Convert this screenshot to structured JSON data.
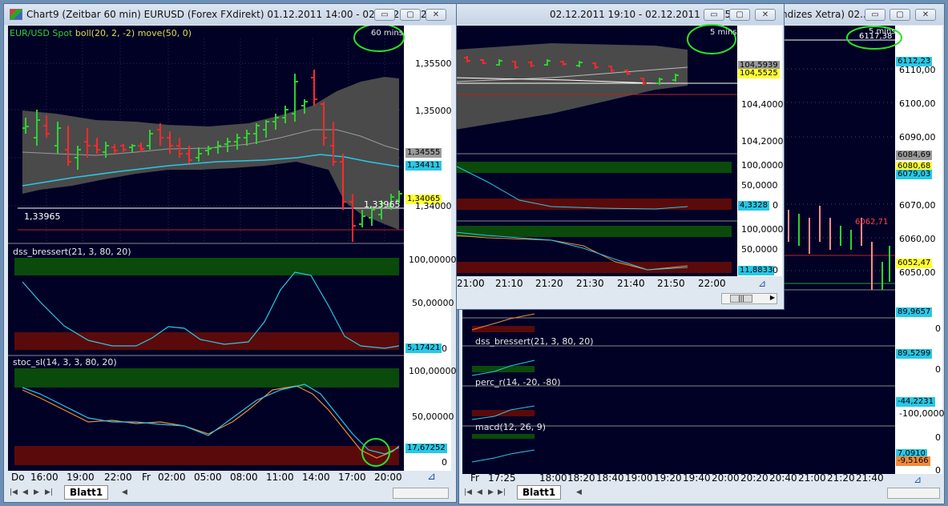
{
  "colors": {
    "chart_bg": "#010126",
    "bull": "#2fd12f",
    "bear": "#ff2a2a",
    "band": "#4a4a4a",
    "ma": "#28c8e6",
    "overbought": "#0a4a0a",
    "oversold": "#5a0a0a",
    "annotation": "#27e427"
  },
  "win1": {
    "title": "Chart9 (Zeitbar 60 min)  EURUSD (Forex FXdirekt) 01.12.2011 14:00 - 02.12.2011 2...",
    "buttons": {
      "min": "▭",
      "max": "▢",
      "close": "✕"
    },
    "legend_symbol": "EUR/USD Spot",
    "legend_ind": "boll(20, 2, -2)",
    "legend_ma": "move(50, 0)",
    "interval_note": "60 mins",
    "price_labels": [
      "1,35500",
      "1,35000",
      "1,34000"
    ],
    "boxes": [
      {
        "text": "1,34555"
      },
      {
        "text": "1,34411"
      },
      {
        "text": "1,34065"
      }
    ],
    "hline_label": "1,33965",
    "hline_label2": "1,33965",
    "pane2_title": "dss_bressert(21, 3, 80, 20)",
    "pane2_labels": [
      "100,00000",
      "50,00000",
      "0"
    ],
    "pane2_box": "5,17421",
    "pane3_title": "stoc_sl(14, 3, 3, 80, 20)",
    "pane3_labels": [
      "100,00000",
      "50,00000",
      "0"
    ],
    "pane3_box": "17,67252",
    "time_labels": [
      "Do",
      "16:00",
      "19:00",
      "22:00",
      "Fr",
      "02:00",
      "05:00",
      "08:00",
      "11:00",
      "14:00",
      "17:00",
      "20:00"
    ],
    "tab": "Blatt1",
    "nav": [
      "|◀",
      "◀",
      "▶",
      "▶|"
    ],
    "scroll_left": "◀"
  },
  "win2": {
    "title": "02.12.2011 19:10 - 02.12.2011 22:05",
    "buttons": {
      "min": "▭",
      "max": "▢",
      "close": "✕"
    },
    "interval_note": "5 mins",
    "price_labels": [
      "104,4000",
      "104,2000"
    ],
    "price_boxes": [
      "104,5939",
      "104,5525"
    ],
    "pane2_labels": [
      "100,0000",
      "50,0000",
      "0"
    ],
    "pane2_box": "4,3328",
    "pane3_labels": [
      "100,0000",
      "50,0000",
      "0"
    ],
    "pane3_box": "11,8833",
    "time_labels": [
      "21:00",
      "21:10",
      "21:20",
      "21:30",
      "21:40",
      "21:50",
      "22:00"
    ],
    "scroll_thumb": "|||",
    "scroll_right": "▶"
  },
  "win3": {
    "title": "ndizes Xetra) 02....",
    "buttons": {
      "min": "▭",
      "max": "▢",
      "close": "✕"
    },
    "interval_note": "5 mins",
    "top_box": "6112,23",
    "top_label": "6117,38",
    "price_labels": [
      "6110,00",
      "6100,00",
      "6090,00",
      "6070,00",
      "6060,00",
      "6050,00"
    ],
    "boxes": [
      "6084,69",
      "6080,68",
      "6079,03",
      "6052,47"
    ],
    "red_label": "6062,71",
    "pane_a_box": "89,9657",
    "pane_a_zero": "0",
    "pane_b_title": "dss_bressert(21, 3, 80, 20)",
    "pane_b_box": "89,5299",
    "pane_b_zero": "0",
    "pane_c_title": "perc_r(14, -20, -80)",
    "pane_c_box": "-44,2231",
    "pane_c_low": "-100,0000",
    "pane_d_title": "macd(12, 26, 9)",
    "pane_d_top": "0",
    "pane_d_box1": "7,0910",
    "pane_d_box2": "-9,5166",
    "pane_d_zero": "0",
    "time_labels": [
      "Fr",
      "17:25",
      "18:00",
      "18:20",
      "18:40",
      "19:00",
      "19:20",
      "19:40",
      "20:00",
      "20:20",
      "20:40",
      "21:00",
      "21:20",
      "21:40"
    ],
    "tab": "Blatt1",
    "nav": [
      "|◀",
      "◀",
      "▶",
      "▶|"
    ],
    "scroll_left": "◀"
  },
  "chart_data": [
    {
      "type": "line",
      "title": "EUR/USD Spot",
      "series": [
        {
          "name": "boll(20, 2, -2)"
        },
        {
          "name": "move(50, 0)"
        }
      ],
      "x_ticks": [
        "Do",
        "16:00",
        "19:00",
        "22:00",
        "Fr",
        "02:00",
        "05:00",
        "08:00",
        "11:00",
        "14:00",
        "17:00",
        "20:00"
      ],
      "y_ticks": [
        1.355,
        1.35,
        1.34
      ],
      "last_close": 1.34065,
      "ma_value": 1.34411,
      "upper_band": 1.34555,
      "hline": 1.33965
    },
    {
      "type": "line",
      "title": "dss_bressert(21, 3, 80, 20)",
      "y_range": [
        0,
        100
      ],
      "last_value": 5.17421
    },
    {
      "type": "line",
      "title": "stoc_sl(14, 3, 3, 80, 20)",
      "y_range": [
        0,
        100
      ],
      "last_value": 17.67252
    }
  ]
}
